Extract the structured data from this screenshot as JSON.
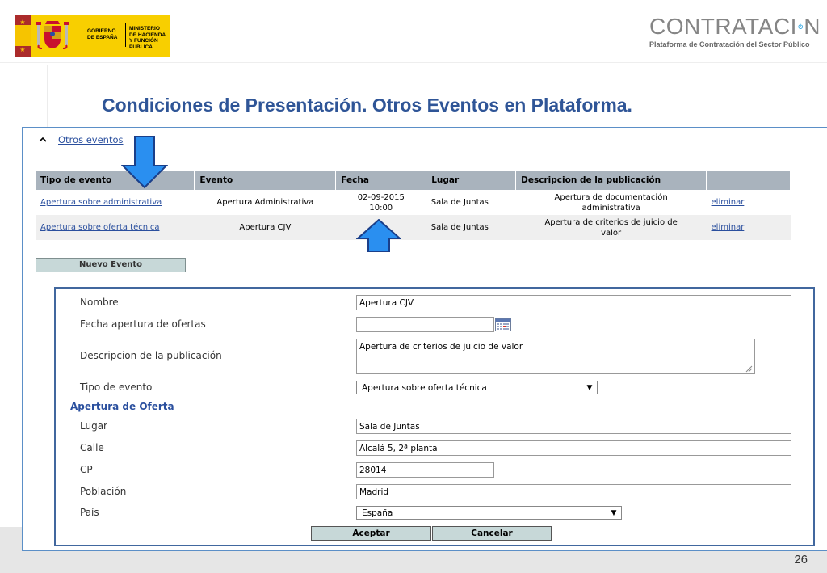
{
  "header": {
    "gov_logo": {
      "left_text": [
        "GOBIERNO",
        "DE ESPAÑA"
      ],
      "right_text": [
        "MINISTERIO",
        "DE HACIENDA",
        "Y FUNCIÓN PÚBLICA"
      ],
      "colors": {
        "flag_red": "#ab2b2b",
        "flag_yellow": "#f6c400",
        "background": "#f8cf00"
      }
    },
    "platform_logo": {
      "wordmark_before": "CONTRATACI",
      "wordmark_after": "N",
      "tagline": "Plataforma de Contratación del Sector Público",
      "colors": {
        "text": "#858585",
        "power_icon": "#29a3e0"
      }
    }
  },
  "slide": {
    "title": "Condiciones de Presentación. Otros Eventos en Plataforma.",
    "page_number": "26",
    "title_color": "#2f5597"
  },
  "section": {
    "toggle_label": "Otros eventos",
    "toggle_icon": "chevron-up-icon"
  },
  "events_table": {
    "columns": [
      "Tipo de evento",
      "Evento",
      "Fecha",
      "Lugar",
      "Descripcion de la publicación",
      ""
    ],
    "rows": [
      {
        "tipo": "Apertura sobre administrativa",
        "evento": "Apertura Administrativa",
        "fecha": [
          "02-09-2015",
          "10:00"
        ],
        "lugar": "Sala de Juntas",
        "descripcion": [
          "Apertura de documentación",
          "administrativa"
        ],
        "action": "eliminar"
      },
      {
        "tipo": "Apertura sobre oferta técnica",
        "evento": "Apertura CJV",
        "fecha": [
          "",
          ""
        ],
        "lugar": "Sala de Juntas",
        "descripcion": [
          "Apertura de criterios de juicio de",
          "valor"
        ],
        "action": "eliminar"
      }
    ]
  },
  "new_event_button": "Nuevo Evento",
  "form": {
    "nombre": {
      "label": "Nombre",
      "value": "Apertura CJV"
    },
    "fecha_apertura": {
      "label": "Fecha apertura de ofertas",
      "value": "",
      "icon": "calendar-icon"
    },
    "descripcion": {
      "label": "Descripcion de la publicación",
      "value": "Apertura de criterios de juicio de valor"
    },
    "tipo_evento": {
      "label": "Tipo de evento",
      "value": "Apertura sobre oferta técnica"
    },
    "subhead": "Apertura de Oferta",
    "lugar": {
      "label": "Lugar",
      "value": "Sala de Juntas"
    },
    "calle": {
      "label": "Calle",
      "value": "Alcalá 5, 2ª planta"
    },
    "cp": {
      "label": "CP",
      "value": "28014"
    },
    "poblacion": {
      "label": "Población",
      "value": "Madrid"
    },
    "pais": {
      "label": "País",
      "value": "España"
    },
    "accept_label": "Aceptar",
    "cancel_label": "Cancelar"
  },
  "annotations": {
    "arrow_color": "#2a8ff0",
    "arrow_icons": [
      "arrow-down-icon",
      "arrow-up-icon"
    ]
  }
}
